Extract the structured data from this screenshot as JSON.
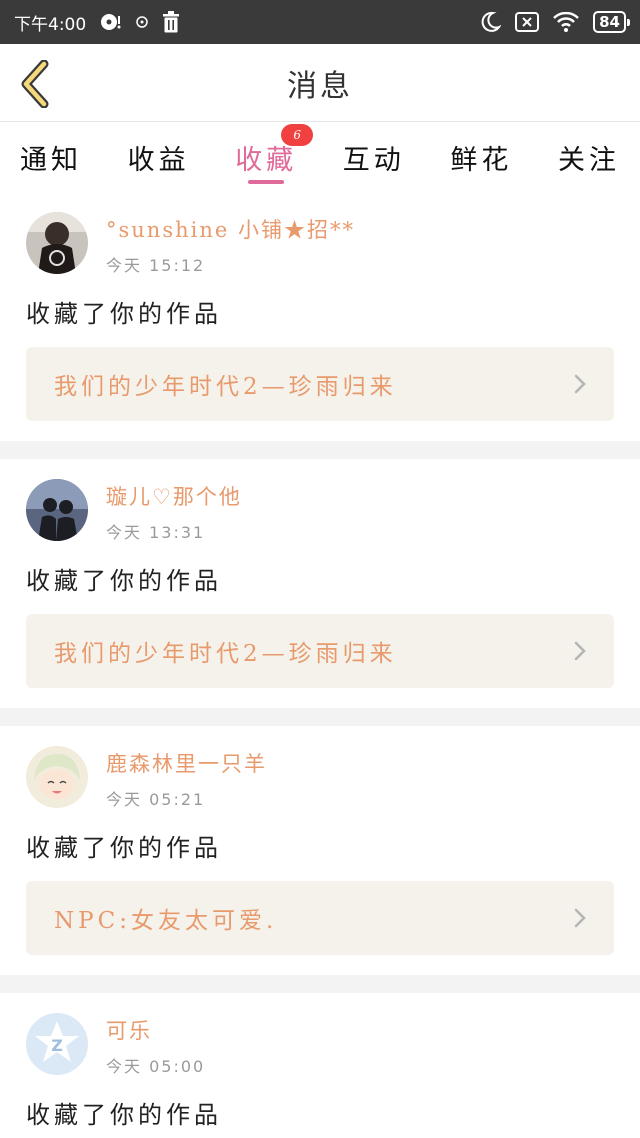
{
  "status_bar": {
    "time": "下午4:00",
    "battery": "84"
  },
  "header": {
    "title": "消息"
  },
  "tabs": [
    {
      "label": "通知"
    },
    {
      "label": "收益"
    },
    {
      "label": "收藏",
      "badge": "6",
      "active": true
    },
    {
      "label": "互动"
    },
    {
      "label": "鲜花"
    },
    {
      "label": "关注"
    }
  ],
  "messages": [
    {
      "username": "°sunshine 小铺★招**",
      "time": "今天 15:12",
      "action": "收藏了你的作品",
      "work_title": "我们的少年时代2—珍雨归来"
    },
    {
      "username": "璇儿♡那个他",
      "time": "今天 13:31",
      "action": "收藏了你的作品",
      "work_title": "我们的少年时代2—珍雨归来"
    },
    {
      "username": "鹿森林里一只羊",
      "time": "今天 05:21",
      "action": "收藏了你的作品",
      "work_title": "NPC:女友太可爱."
    },
    {
      "username": "可乐",
      "time": "今天 05:00",
      "action": "收藏了你的作品",
      "work_title": ""
    }
  ],
  "colors": {
    "accent_pink": "#e06a9a",
    "username_orange": "#e89a6c",
    "badge_red": "#f04040",
    "link_bg": "#f4f2ea"
  }
}
